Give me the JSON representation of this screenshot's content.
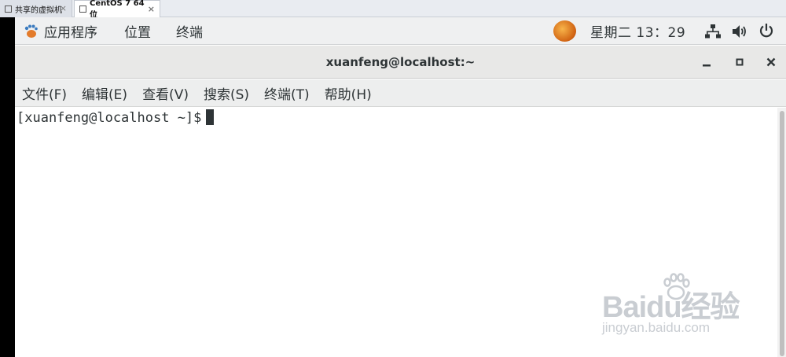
{
  "vm_tabs": [
    {
      "label": "共享的虚拟机",
      "close": "×"
    },
    {
      "label": "CentOS 7 64 位",
      "close": "×"
    }
  ],
  "topbar": {
    "applications": "应用程序",
    "places": "位置",
    "terminal": "终端",
    "clock": "星期二 13：29"
  },
  "window": {
    "title": "xuanfeng@localhost:~"
  },
  "menubar": {
    "items": [
      "文件(F)",
      "编辑(E)",
      "查看(V)",
      "搜索(S)",
      "终端(T)",
      "帮助(H)"
    ]
  },
  "terminal": {
    "prompt": "[xuanfeng@localhost ~]$"
  },
  "watermark": {
    "brand": "Baidu经验",
    "url": "jingyan.baidu.com"
  },
  "colors": {
    "topbar_bg": "#eff0f1",
    "titlebar_bg": "#e8e8e7",
    "text": "#2e3436",
    "clock_icon": "#d06212"
  },
  "icons": {
    "apps": "gnome-foot-icon",
    "network": "network-wired-icon",
    "volume": "speaker-icon",
    "power": "power-icon"
  }
}
